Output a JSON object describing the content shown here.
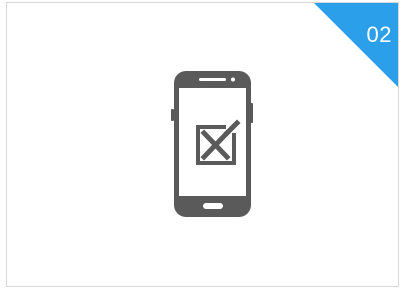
{
  "card": {
    "step_number": "02",
    "icon": "phone-with-checkbox-x-icon",
    "colors": {
      "accent": "#2b9fe9",
      "icon": "#5a5a5a",
      "border": "#d8d8d8",
      "background": "#ffffff"
    }
  }
}
